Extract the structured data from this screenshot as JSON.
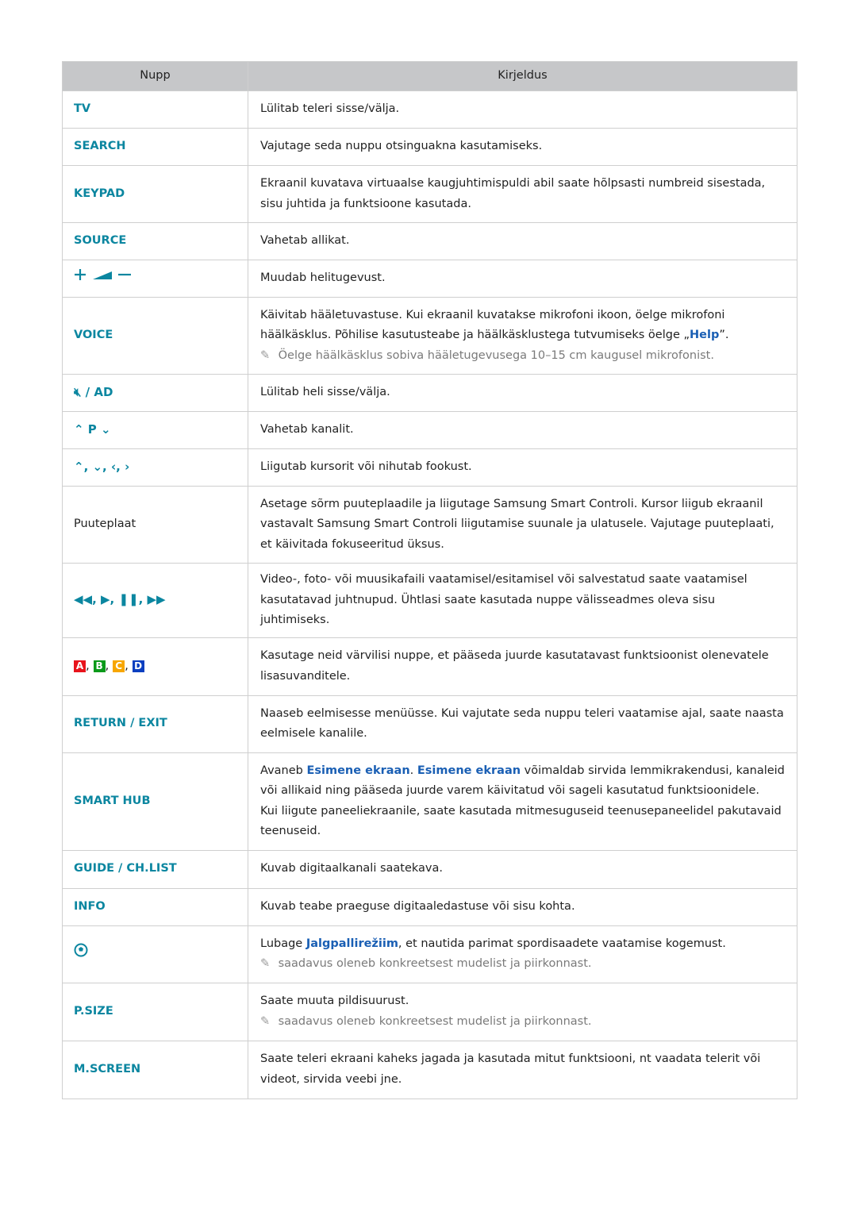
{
  "header": {
    "col1": "Nupp",
    "col2": "Kirjeldus"
  },
  "colors": {
    "key": "#0b86a0",
    "link": "#1a5fb4",
    "A": "#e8141c",
    "B": "#0a9a1a",
    "C": "#f7a600",
    "D": "#0b3fc0"
  },
  "rows": [
    {
      "key": "TV",
      "h": 47,
      "desc": [
        [
          {
            "t": "Lülitab teleri sisse/välja."
          }
        ]
      ]
    },
    {
      "key": "SEARCH",
      "h": 47,
      "desc": [
        [
          {
            "t": "Vajutage seda nuppu otsinguakna kasutamiseks."
          }
        ]
      ]
    },
    {
      "key": "KEYPAD",
      "h": 72,
      "desc": [
        [
          {
            "t": "Ekraanil kuvatava virtuaalse kaugjuhtimispuldi abil saate hõlpsasti numbreid sisestada, sisu juhtida ja funktsioone kasutada."
          }
        ]
      ]
    },
    {
      "key": "SOURCE",
      "h": 47,
      "desc": [
        [
          {
            "t": "Vahetab allikat."
          }
        ]
      ]
    },
    {
      "icon": "volume",
      "keytext": "+ ◢ −",
      "h": 47,
      "desc": [
        [
          {
            "t": "Muudab helitugevust."
          }
        ]
      ]
    },
    {
      "key": "VOICE",
      "h": 97,
      "desc": [
        [
          {
            "t": "Käivitab hääletuvastuse. Kui ekraanil kuvatakse mikrofoni ikoon, öelge mikrofoni häälkäsklus. Põhilise kasutusteabe ja häälkäsklustega tutvumiseks öelge „"
          },
          {
            "t": "Help",
            "b": true
          },
          {
            "t": "”."
          }
        ]
      ],
      "note": "Öelge häälkäsklus sobiva hääletugevusega 10–15 cm kaugusel mikrofonist."
    },
    {
      "icon": "mute",
      "keytext": "🔇︎ / AD",
      "h": 47,
      "desc": [
        [
          {
            "t": "Lülitab heli sisse/välja."
          }
        ]
      ]
    },
    {
      "icon": "channel",
      "keytext": "⌃ P ⌄",
      "h": 47,
      "desc": [
        [
          {
            "t": "Vahetab kanalit."
          }
        ]
      ]
    },
    {
      "icon": "arrows",
      "keytext": "⌃, ⌄, ‹, ›",
      "h": 47,
      "desc": [
        [
          {
            "t": "Liigutab kursorit või nihutab fookust."
          }
        ]
      ]
    },
    {
      "key": "Puuteplaat",
      "plain": true,
      "h": 97,
      "desc": [
        [
          {
            "t": "Asetage sõrm puuteplaadile ja liigutage Samsung Smart Controli. Kursor liigub ekraanil vastavalt Samsung Smart Controli liigutamise suunale ja ulatusele. Vajutage puuteplaati, et käivitada fokuseeritud üksus."
          }
        ]
      ]
    },
    {
      "icon": "media",
      "keytext": "◀◀, ▶, ❚❚, ▶▶",
      "h": 73,
      "desc": [
        [
          {
            "t": "Video-, foto- või muusikafaili vaatamisel/esitamisel või salvestatud saate vaatamisel kasutatavad juhtnupud. Ühtlasi saate kasutada nuppe välisseadmes oleva sisu juhtimiseks."
          }
        ]
      ]
    },
    {
      "icon": "color",
      "keytext": "A, B, C, D",
      "h": 73,
      "desc": [
        [
          {
            "t": "Kasutage neid värvilisi nuppe, et pääseda juurde kasutatavast funktsioonist olenevatele lisasuvanditele."
          }
        ]
      ]
    },
    {
      "key": "RETURN / EXIT",
      "h": 72,
      "desc": [
        [
          {
            "t": "Naaseb eelmisesse menüüsse. Kui vajutate seda nuppu teleri vaatamise ajal, saate naasta eelmisele kanalile."
          }
        ]
      ]
    },
    {
      "key": "SMART HUB",
      "h": 123,
      "desc": [
        [
          {
            "t": "Avaneb "
          },
          {
            "t": "Esimene ekraan",
            "b": true
          },
          {
            "t": ". "
          },
          {
            "t": "Esimene ekraan",
            "b": true
          },
          {
            "t": " võimaldab sirvida lemmikrakendusi, kanaleid või allikaid ning pääseda juurde varem käivitatud või sageli kasutatud funktsioonidele."
          }
        ],
        [
          {
            "t": "Kui liigute paneeliekraanile, saate kasutada mitmesuguseid teenusepaneelidel pakutavaid teenuseid."
          }
        ]
      ]
    },
    {
      "key": "GUIDE / CH.LIST",
      "h": 48,
      "desc": [
        [
          {
            "t": "Kuvab digitaalkanali saatekava."
          }
        ]
      ]
    },
    {
      "key": "INFO",
      "h": 47,
      "desc": [
        [
          {
            "t": "Kuvab teabe praeguse digitaaledastuse või sisu kohta."
          }
        ]
      ]
    },
    {
      "icon": "football",
      "keytext": "⚽︎",
      "h": 72,
      "desc": [
        [
          {
            "t": "Lubage "
          },
          {
            "t": "Jalgpallirežiim",
            "b": true
          },
          {
            "t": ", et nautida parimat spordisaadete vaatamise kogemust."
          }
        ]
      ],
      "note": "saadavus oleneb konkreetsest mudelist ja piirkonnast."
    },
    {
      "key": "P.SIZE",
      "h": 73,
      "desc": [
        [
          {
            "t": "Saate muuta pildisuurust."
          }
        ]
      ],
      "note": "saadavus oleneb konkreetsest mudelist ja piirkonnast."
    },
    {
      "key": "M.SCREEN",
      "h": 73,
      "desc": [
        [
          {
            "t": "Saate teleri ekraani kaheks jagada ja kasutada mitut funktsiooni, nt vaadata telerit või videot, sirvida veebi jne."
          }
        ]
      ]
    }
  ]
}
